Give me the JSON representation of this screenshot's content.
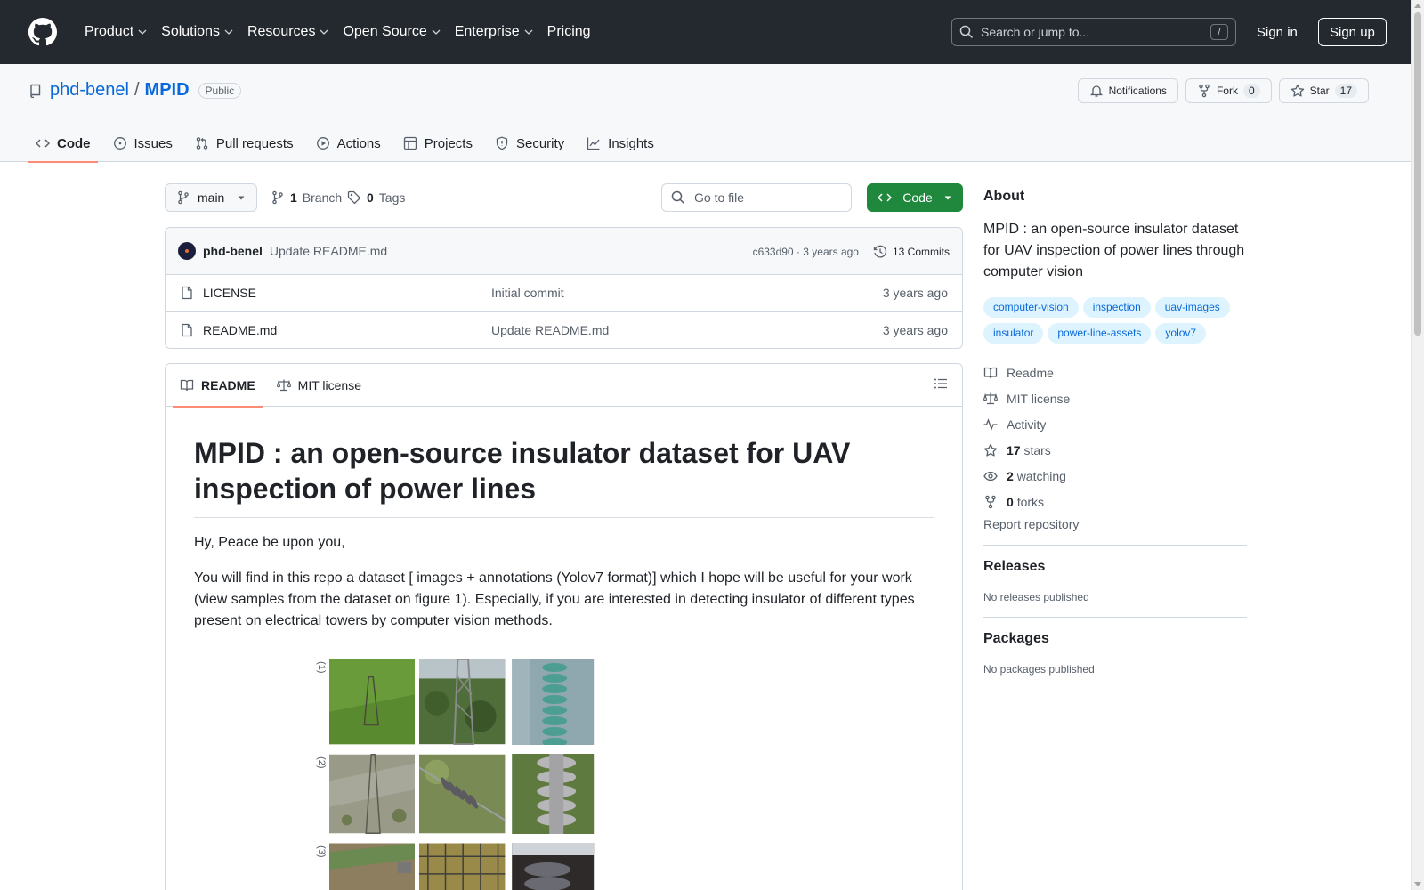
{
  "header": {
    "nav": [
      "Product",
      "Solutions",
      "Resources",
      "Open Source",
      "Enterprise",
      "Pricing"
    ],
    "search_placeholder": "Search or jump to...",
    "search_kbd": "/",
    "sign_in": "Sign in",
    "sign_up": "Sign up"
  },
  "repo": {
    "owner": "phd-benel",
    "slash": "/",
    "name": "MPID",
    "visibility": "Public",
    "notifications_label": "Notifications",
    "fork_label": "Fork",
    "fork_count": "0",
    "star_label": "Star",
    "star_count": "17",
    "tabs": [
      "Code",
      "Issues",
      "Pull requests",
      "Actions",
      "Projects",
      "Security",
      "Insights"
    ]
  },
  "file_nav": {
    "branch": "main",
    "branch_count": "1",
    "branch_label": "Branch",
    "tag_count": "0",
    "tag_label": "Tags",
    "goto_placeholder": "Go to file",
    "code_label": "Code"
  },
  "commit": {
    "author": "phd-benel",
    "message": "Update README.md",
    "meta": "c633d90 · 3 years ago",
    "count": "13 Commits"
  },
  "files": [
    {
      "name": "LICENSE",
      "message": "Initial commit",
      "date": "3 years ago"
    },
    {
      "name": "README.md",
      "message": "Update README.md",
      "date": "3 years ago"
    }
  ],
  "readme": {
    "tabs": [
      "README",
      "MIT license"
    ],
    "title": "MPID : an open-source insulator dataset for UAV inspection of power lines",
    "p1": "Hy, Peace be upon you,",
    "p2": "You will find in this repo a dataset [ images + annotations (Yolov7 format)] which I hope will be useful for your work (view samples from the dataset on figure 1). Especially, if you are interested in detecting insulator of different types present on electrical towers by computer vision methods.",
    "figure_labels": [
      "(1)",
      "(2)",
      "(3)"
    ]
  },
  "about": {
    "heading": "About",
    "description": "MPID : an open-source insulator dataset for UAV inspection of power lines through computer vision",
    "topics": [
      "computer-vision",
      "inspection",
      "uav-images",
      "insulator",
      "power-line-assets",
      "yolov7"
    ],
    "links": {
      "readme": "Readme",
      "license": "MIT license",
      "activity": "Activity",
      "stars_count": "17",
      "stars_label": "stars",
      "watching_count": "2",
      "watching_label": "watching",
      "forks_count": "0",
      "forks_label": "forks"
    },
    "report": "Report repository"
  },
  "releases": {
    "heading": "Releases",
    "empty": "No releases published"
  },
  "packages": {
    "heading": "Packages",
    "empty": "No packages published"
  },
  "colors": {
    "header_bg": "#24292f",
    "link": "#0969da",
    "green": "#1f883d",
    "tab_underline": "#fd8c73",
    "topic_bg": "#ddf4ff"
  }
}
